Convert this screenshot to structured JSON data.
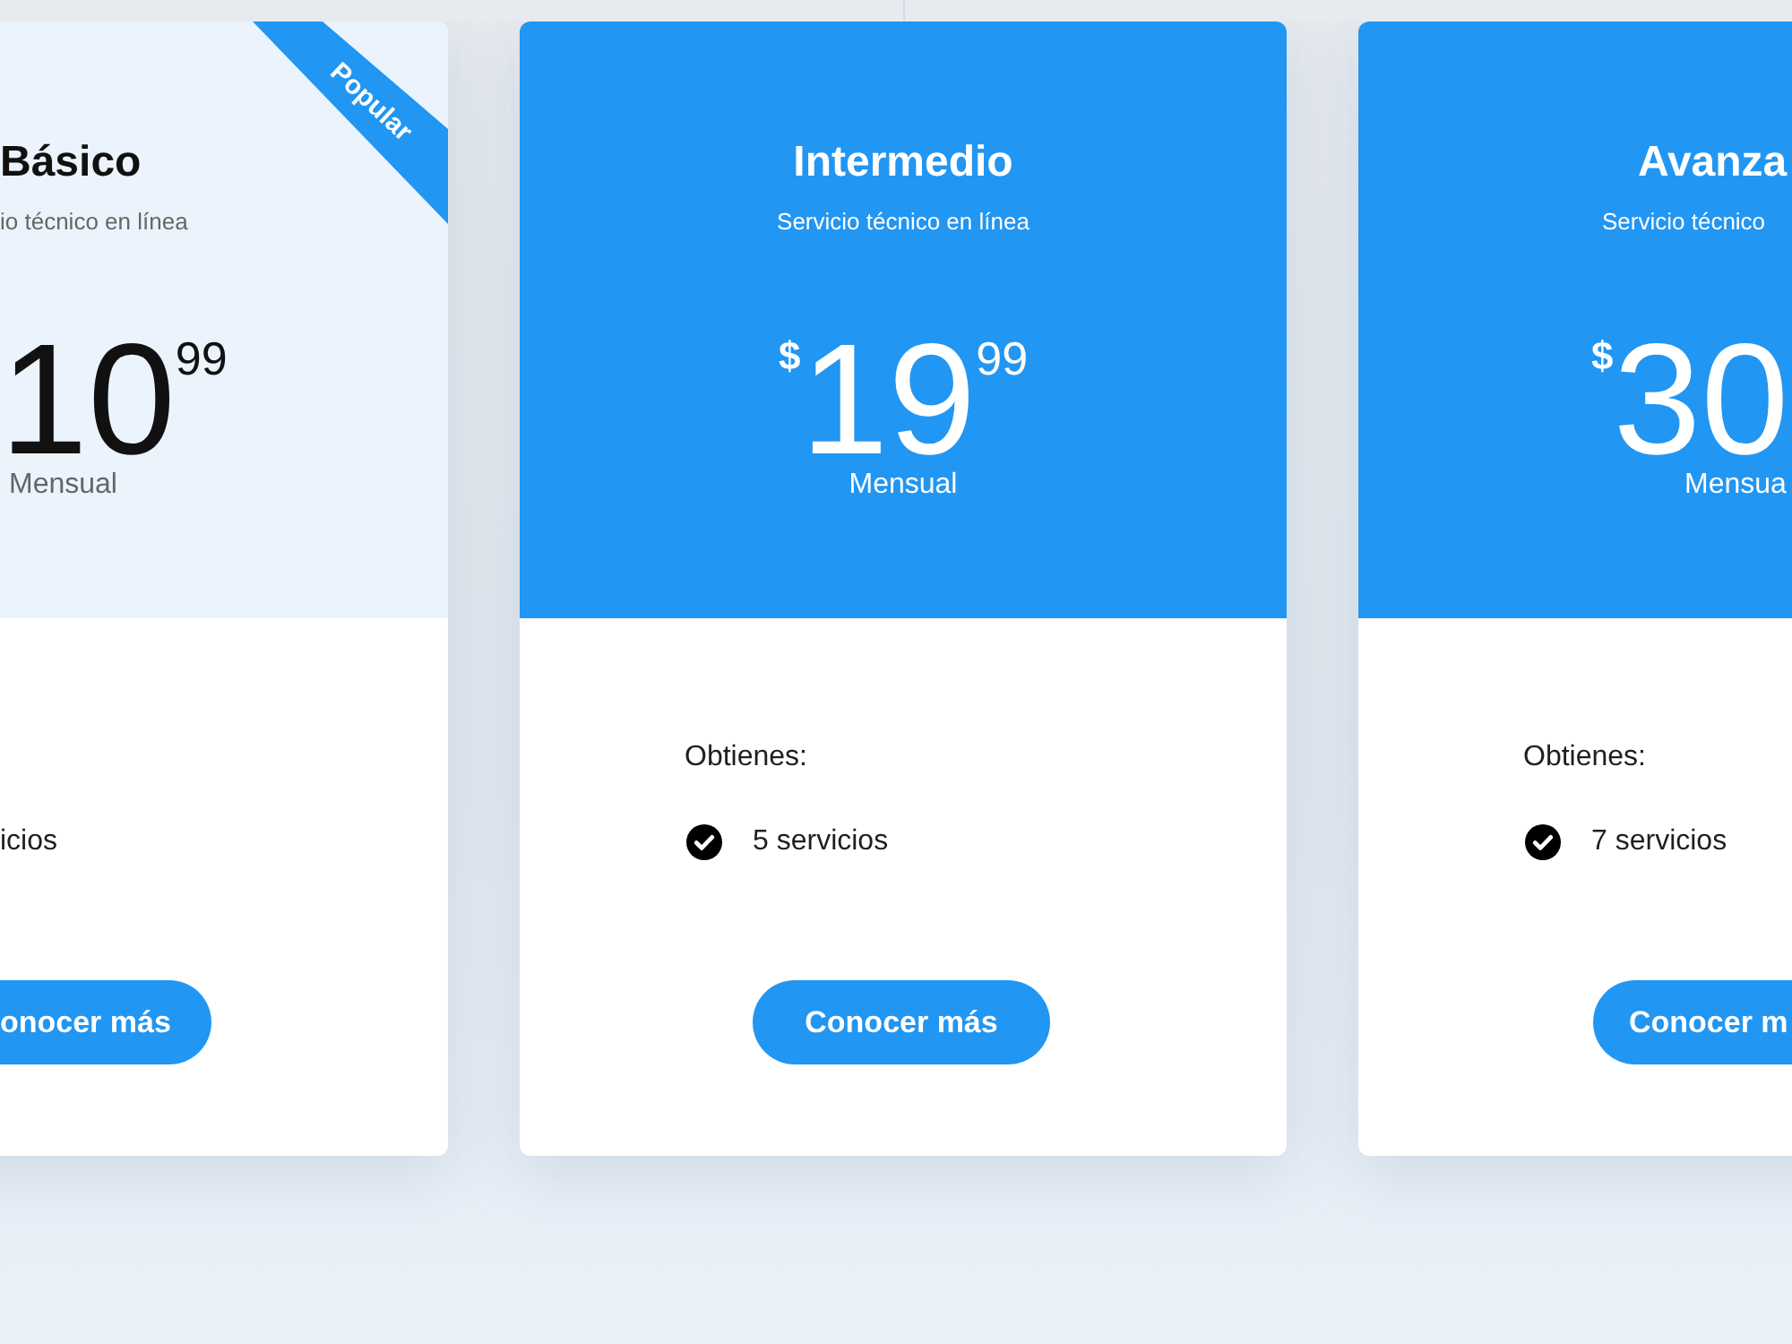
{
  "plans": [
    {
      "kind": "light",
      "ribbon": "Popular",
      "title": "Básico",
      "subtitle": "io técnico en línea",
      "price": "10",
      "cents": "99",
      "period": "Mensual",
      "features": [
        {
          "text": "icios",
          "checked": false
        }
      ],
      "button": "onocer más"
    },
    {
      "kind": "solid",
      "title": "Intermedio",
      "subtitle": "Servicio técnico en línea",
      "currency": "$",
      "price": "19",
      "cents": "99",
      "period": "Mensual",
      "features_heading": "Obtienes:",
      "features": [
        {
          "text": "5 servicios",
          "checked": true
        }
      ],
      "button": "Conocer más"
    },
    {
      "kind": "solid",
      "title": "Avanza",
      "subtitle": "Servicio técnico",
      "currency": "$",
      "price": "30",
      "period": "Mensua",
      "features_heading": "Obtienes:",
      "features": [
        {
          "text": "7 servicios",
          "checked": true
        }
      ],
      "button": "Conocer m"
    }
  ]
}
